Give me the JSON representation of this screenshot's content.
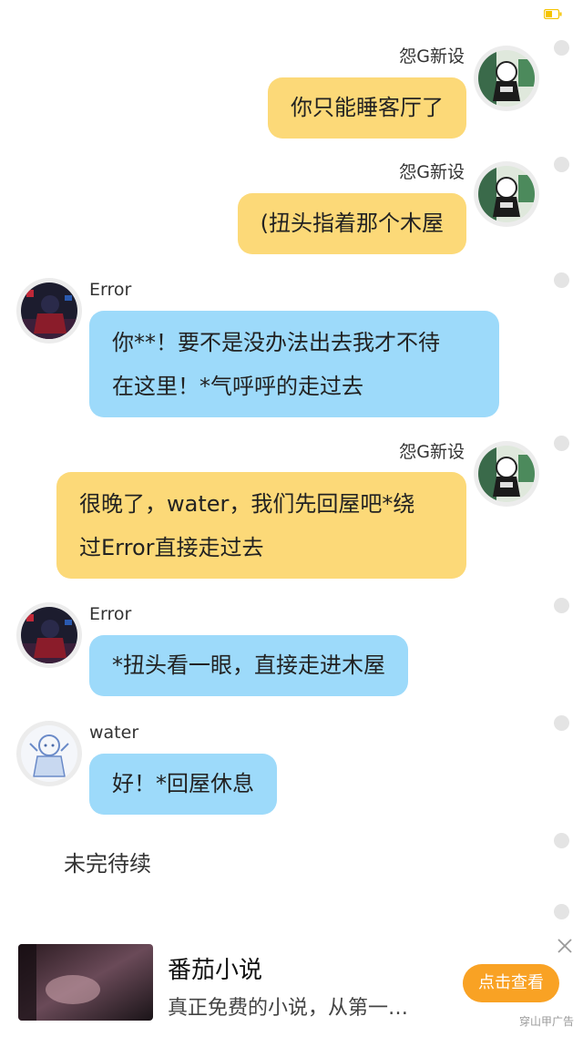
{
  "status": {
    "battery_icon": "battery-icon"
  },
  "messages": [
    {
      "sender": "怨G新设",
      "side": "right",
      "lines": [
        "你只能睡客厅了"
      ]
    },
    {
      "sender": "怨G新设",
      "side": "right",
      "lines": [
        "(扭头指着那个木屋"
      ]
    },
    {
      "sender": "Error",
      "side": "left",
      "lines": [
        "你**！要不是没办法出去我才不待",
        "在这里！*气呼呼的走过去"
      ]
    },
    {
      "sender": "怨G新设",
      "side": "right",
      "lines": [
        "很晚了，water，我们先回屋吧*绕",
        "过Error直接走过去"
      ]
    },
    {
      "sender": "Error",
      "side": "left",
      "lines": [
        "*扭头看一眼，直接走进木屋"
      ]
    },
    {
      "sender": "water",
      "side": "left",
      "lines": [
        "好！*回屋休息"
      ]
    }
  ],
  "footer": {
    "text": "未完待续"
  },
  "ad": {
    "title": "番茄小说",
    "description": "真正免费的小说，从第一…",
    "button_label": "点击查看",
    "source": "穿山甲广告"
  },
  "colors": {
    "right_bubble": "#fcd978",
    "left_bubble": "#9ddafa",
    "ad_button": "#f9a224",
    "timeline_dot": "#e4e4e4"
  }
}
